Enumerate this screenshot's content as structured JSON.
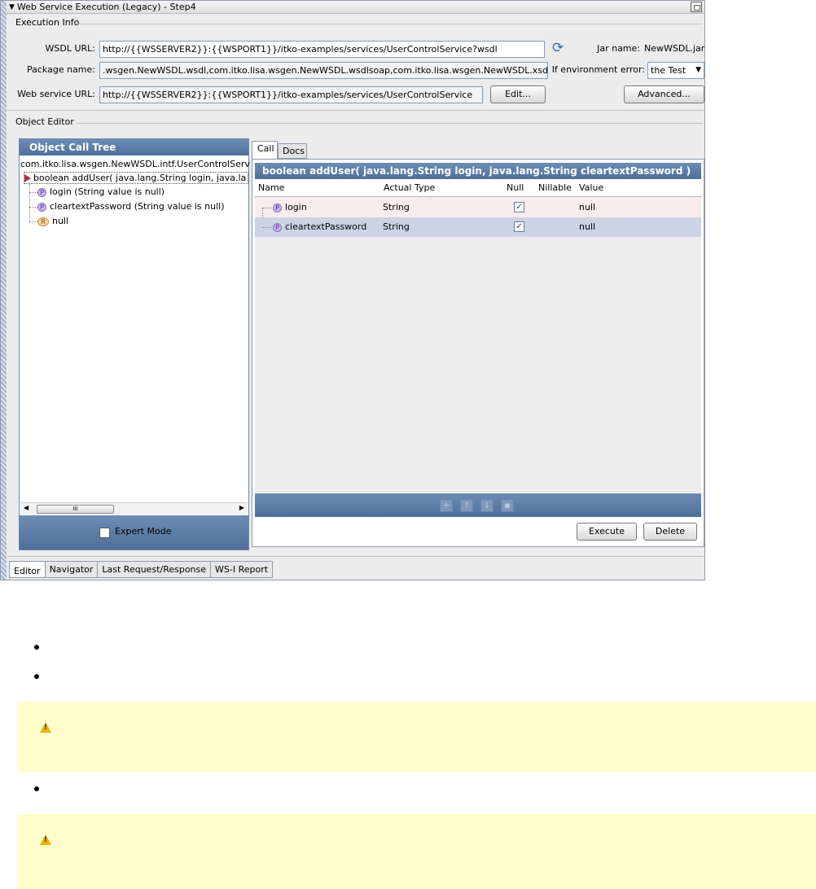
{
  "window": {
    "title": "Web Service Execution (Legacy) - Step4"
  },
  "execution_info": {
    "section_title": "Execution Info",
    "wsdl_label": "WSDL URL:",
    "wsdl_value": "http://{{WSSERVER2}}:{{WSPORT1}}/itko-examples/services/UserControlService?wsdl",
    "jar_label": "Jar name:",
    "jar_value": "NewWSDL.jar",
    "package_label": "Package name:",
    "package_value": ".wsgen.NewWSDL.wsdl,com.itko.lisa.wsgen.NewWSDL.wsdlsoap,com.itko.lisa.wsgen.NewWSDL.xsd",
    "env_error_label": "If environment error:",
    "env_error_value": "the Test",
    "ws_url_label": "Web service URL:",
    "ws_url_value": "http://{{WSSERVER2}}:{{WSPORT1}}/itko-examples/services/UserControlService",
    "edit_button": "Edit...",
    "advanced_button": "Advanced..."
  },
  "object_editor": {
    "section_title": "Object Editor",
    "tree": {
      "header": "Object Call Tree",
      "root": "com.itko.lisa.wsgen.NewWSDL.intf.UserControlServ",
      "method": "boolean addUser( java.lang.String login, java.la",
      "params": [
        {
          "icon": "p",
          "label": "login (String value is null)"
        },
        {
          "icon": "p",
          "label": "cleartextPassword (String value is null)"
        }
      ],
      "return": {
        "icon": "r",
        "label": "null"
      },
      "scroll_thumb": "III",
      "expert_mode_label": "Expert Mode",
      "expert_mode_checked": false
    },
    "tabs": [
      "Call",
      "Docs"
    ],
    "active_tab": "Call",
    "signature": "boolean addUser( java.lang.String login, java.lang.String cleartextPassword )",
    "columns": [
      "Name",
      "Actual Type",
      "Null",
      "Nillable",
      "Value"
    ],
    "rows": [
      {
        "name": "login",
        "type": "String",
        "null": true,
        "value": "null"
      },
      {
        "name": "cleartextPassword",
        "type": "String",
        "null": true,
        "value": "null"
      }
    ],
    "tool_icons": [
      "add-icon",
      "move-up-icon",
      "move-down-icon",
      "delete-row-icon"
    ],
    "execute_button": "Execute",
    "delete_button": "Delete"
  },
  "bottom_tabs": [
    "Editor",
    "Navigator",
    "Last Request/Response",
    "WS-I Report"
  ],
  "colors": {
    "panel_header": "#5a7ca6",
    "selected_row": "#cbd4e4",
    "first_row": "#f8ecec",
    "note_background": "#ffffcc",
    "warning_icon": "#e8b400"
  }
}
